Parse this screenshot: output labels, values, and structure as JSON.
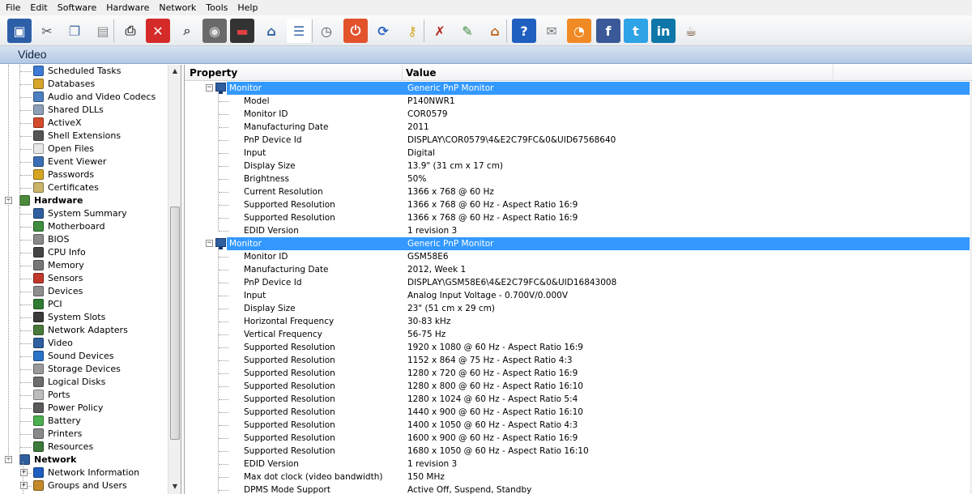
{
  "menu": [
    "File",
    "Edit",
    "Software",
    "Hardware",
    "Network",
    "Tools",
    "Help"
  ],
  "toolbar": [
    {
      "icon": "floppy-save-icon",
      "glyph": "▣",
      "bg": "#2c5fa8",
      "fg": "#ffffff"
    },
    {
      "icon": "scissors-icon",
      "glyph": "✂",
      "bg": "transparent",
      "fg": "#555555"
    },
    {
      "icon": "copy-icon",
      "glyph": "❐",
      "bg": "transparent",
      "fg": "#4a6fa5"
    },
    {
      "icon": "paste-icon",
      "glyph": "▤",
      "bg": "transparent",
      "fg": "#8a8a8a"
    },
    {
      "icon": "printer-icon",
      "glyph": "⎙",
      "bg": "transparent",
      "fg": "#444444"
    },
    {
      "icon": "stop-icon",
      "glyph": "✕",
      "bg": "#d42a2a",
      "fg": "#ffffff"
    },
    {
      "icon": "magnifier-icon",
      "glyph": "⌕",
      "bg": "transparent",
      "fg": "#555555"
    },
    {
      "icon": "compass-icon",
      "glyph": "◉",
      "bg": "#6a6a6a",
      "fg": "#e0e0e0"
    },
    {
      "icon": "monitor-graph-icon",
      "glyph": "▬",
      "bg": "#333333",
      "fg": "#e04040"
    },
    {
      "icon": "network-computer-icon",
      "glyph": "⌂",
      "bg": "transparent",
      "fg": "#2b5c9e"
    },
    {
      "icon": "list-report-icon",
      "glyph": "☰",
      "bg": "#ffffff",
      "fg": "#3a6aa8"
    },
    {
      "icon": "stopwatch-icon",
      "glyph": "◷",
      "bg": "transparent",
      "fg": "#555555"
    },
    {
      "icon": "power-icon",
      "glyph": "⏻",
      "bg": "#e2532c",
      "fg": "#ffffff"
    },
    {
      "icon": "refresh-icon",
      "glyph": "⟳",
      "bg": "transparent",
      "fg": "#2a62c0"
    },
    {
      "icon": "key-icon",
      "glyph": "⚷",
      "bg": "transparent",
      "fg": "#d6a623"
    },
    {
      "icon": "tools-icon",
      "glyph": "✗",
      "bg": "transparent",
      "fg": "#b3261e"
    },
    {
      "icon": "wizard-icon",
      "glyph": "✎",
      "bg": "transparent",
      "fg": "#3a8a3a"
    },
    {
      "icon": "home-icon",
      "glyph": "⌂",
      "bg": "transparent",
      "fg": "#c0641c"
    },
    {
      "icon": "help-icon",
      "glyph": "?",
      "bg": "#1f5fbf",
      "fg": "#ffffff"
    },
    {
      "icon": "mail-icon",
      "glyph": "✉",
      "bg": "transparent",
      "fg": "#777777"
    },
    {
      "icon": "rss-icon",
      "glyph": "◔",
      "bg": "#f08a24",
      "fg": "#ffffff"
    },
    {
      "icon": "facebook-icon",
      "glyph": "f",
      "bg": "#3b5998",
      "fg": "#ffffff"
    },
    {
      "icon": "twitter-icon",
      "glyph": "t",
      "bg": "#2ea3e6",
      "fg": "#ffffff"
    },
    {
      "icon": "linkedin-icon",
      "glyph": "in",
      "bg": "#0e76a8",
      "fg": "#ffffff"
    },
    {
      "icon": "coffee-cup-icon",
      "glyph": "☕",
      "bg": "transparent",
      "fg": "#6b3d1e"
    }
  ],
  "title": "Video",
  "tree": [
    {
      "label": "Scheduled Tasks",
      "icon": "scheduled-tasks-icon",
      "color": "#3d7bd6",
      "level": 2
    },
    {
      "label": "Databases",
      "icon": "databases-icon",
      "color": "#d7a52b",
      "level": 2
    },
    {
      "label": "Audio and Video Codecs",
      "icon": "codecs-icon",
      "color": "#4c7fbf",
      "level": 2
    },
    {
      "label": "Shared DLLs",
      "icon": "shared-dlls-icon",
      "color": "#8da0b8",
      "level": 2
    },
    {
      "label": "ActiveX",
      "icon": "activex-icon",
      "color": "#d44a2c",
      "level": 2
    },
    {
      "label": "Shell Extensions",
      "icon": "shell-extensions-icon",
      "color": "#555555",
      "level": 2
    },
    {
      "label": "Open Files",
      "icon": "open-files-icon",
      "color": "#e8e8e8",
      "level": 2
    },
    {
      "label": "Event Viewer",
      "icon": "event-viewer-icon",
      "color": "#3b6fb5",
      "level": 2
    },
    {
      "label": "Passwords",
      "icon": "key-icon",
      "color": "#d6a623",
      "level": 2
    },
    {
      "label": "Certificates",
      "icon": "certificates-icon",
      "color": "#c9b46a",
      "level": 2
    },
    {
      "label": "Hardware",
      "icon": "hardware-icon",
      "color": "#4a8a3a",
      "level": 1,
      "cat": true
    },
    {
      "label": "System Summary",
      "icon": "system-summary-icon",
      "color": "#2f5f9f",
      "level": 2
    },
    {
      "label": "Motherboard",
      "icon": "motherboard-icon",
      "color": "#3e8c3e",
      "level": 2
    },
    {
      "label": "BIOS",
      "icon": "bios-icon",
      "color": "#8a8a8a",
      "level": 2
    },
    {
      "label": "CPU Info",
      "icon": "cpu-icon",
      "color": "#444444",
      "level": 2
    },
    {
      "label": "Memory",
      "icon": "memory-icon",
      "color": "#777777",
      "level": 2
    },
    {
      "label": "Sensors",
      "icon": "sensors-icon",
      "color": "#c0392b",
      "level": 2
    },
    {
      "label": "Devices",
      "icon": "devices-icon",
      "color": "#8e8e8e",
      "level": 2
    },
    {
      "label": "PCI",
      "icon": "pci-icon",
      "color": "#2e7d32",
      "level": 2
    },
    {
      "label": "System Slots",
      "icon": "system-slots-icon",
      "color": "#3a3a3a",
      "level": 2
    },
    {
      "label": "Network Adapters",
      "icon": "network-adapters-icon",
      "color": "#4a7a3a",
      "level": 2
    },
    {
      "label": "Video",
      "icon": "video-monitor-icon",
      "color": "#2f5f9f",
      "level": 2,
      "selected": true
    },
    {
      "label": "Sound Devices",
      "icon": "sound-devices-icon",
      "color": "#2a72c8",
      "level": 2
    },
    {
      "label": "Storage Devices",
      "icon": "storage-devices-icon",
      "color": "#9a9a9a",
      "level": 2
    },
    {
      "label": "Logical Disks",
      "icon": "logical-disks-icon",
      "color": "#6d6d6d",
      "level": 2
    },
    {
      "label": "Ports",
      "icon": "ports-icon",
      "color": "#bdbdbd",
      "level": 2
    },
    {
      "label": "Power Policy",
      "icon": "power-policy-icon",
      "color": "#5a5a5a",
      "level": 2
    },
    {
      "label": "Battery",
      "icon": "battery-icon",
      "color": "#4caf50",
      "level": 2
    },
    {
      "label": "Printers",
      "icon": "printers-icon",
      "color": "#8a8a8a",
      "level": 2
    },
    {
      "label": "Resources",
      "icon": "resources-icon",
      "color": "#3b7a3b",
      "level": 2
    },
    {
      "label": "Network",
      "icon": "network-icon",
      "color": "#2f5f9f",
      "level": 1,
      "cat": true
    },
    {
      "label": "Network Information",
      "icon": "network-information-icon",
      "color": "#1f5fbf",
      "level": 2,
      "expandable": true
    },
    {
      "label": "Groups and Users",
      "icon": "groups-users-icon",
      "color": "#c48a2a",
      "level": 2,
      "expandable": true
    }
  ],
  "columns": {
    "property": "Property",
    "value": "Value"
  },
  "rows": [
    {
      "group": true,
      "name": "Monitor",
      "value": "Generic PnP Monitor"
    },
    {
      "name": "Model",
      "value": "P140NWR1"
    },
    {
      "name": "Monitor ID",
      "value": "COR0579"
    },
    {
      "name": "Manufacturing Date",
      "value": "2011"
    },
    {
      "name": "PnP Device Id",
      "value": "DISPLAY\\COR0579\\4&E2C79FC&0&UID67568640"
    },
    {
      "name": "Input",
      "value": "Digital"
    },
    {
      "name": "Display Size",
      "value": "13.9\" (31 cm x 17 cm)"
    },
    {
      "name": "Brightness",
      "value": "50%"
    },
    {
      "name": "Current Resolution",
      "value": "1366 x 768 @ 60 Hz"
    },
    {
      "name": "Supported Resolution",
      "value": "1366 x 768 @ 60 Hz - Aspect Ratio 16:9"
    },
    {
      "name": "Supported Resolution",
      "value": "1366 x 768 @ 60 Hz - Aspect Ratio 16:9"
    },
    {
      "name": "EDID Version",
      "value": "1 revision 3"
    },
    {
      "group": true,
      "name": "Monitor",
      "value": "Generic PnP Monitor"
    },
    {
      "name": "Monitor ID",
      "value": "GSM58E6"
    },
    {
      "name": "Manufacturing Date",
      "value": "2012, Week 1"
    },
    {
      "name": "PnP Device Id",
      "value": "DISPLAY\\GSM58E6\\4&E2C79FC&0&UID16843008"
    },
    {
      "name": "Input",
      "value": "Analog Input Voltage - 0.700V/0.000V"
    },
    {
      "name": "Display Size",
      "value": "23\" (51 cm x 29 cm)"
    },
    {
      "name": "Horizontal Frequency",
      "value": "30-83 kHz"
    },
    {
      "name": "Vertical Frequency",
      "value": "56-75 Hz"
    },
    {
      "name": "Supported Resolution",
      "value": "1920 x 1080 @ 60 Hz - Aspect Ratio 16:9"
    },
    {
      "name": "Supported Resolution",
      "value": "1152 x 864 @ 75 Hz - Aspect Ratio 4:3"
    },
    {
      "name": "Supported Resolution",
      "value": "1280 x 720 @ 60 Hz - Aspect Ratio 16:9"
    },
    {
      "name": "Supported Resolution",
      "value": "1280 x 800 @ 60 Hz - Aspect Ratio 16:10"
    },
    {
      "name": "Supported Resolution",
      "value": "1280 x 1024 @ 60 Hz - Aspect Ratio 5:4"
    },
    {
      "name": "Supported Resolution",
      "value": "1440 x 900 @ 60 Hz - Aspect Ratio 16:10"
    },
    {
      "name": "Supported Resolution",
      "value": "1400 x 1050 @ 60 Hz - Aspect Ratio 4:3"
    },
    {
      "name": "Supported Resolution",
      "value": "1600 x 900 @ 60 Hz - Aspect Ratio 16:9"
    },
    {
      "name": "Supported Resolution",
      "value": "1680 x 1050 @ 60 Hz - Aspect Ratio 16:10"
    },
    {
      "name": "EDID Version",
      "value": "1 revision 3"
    },
    {
      "name": "Max dot clock (video bandwidth)",
      "value": "150 MHz"
    },
    {
      "name": "DPMS Mode Support",
      "value": "Active Off, Suspend, Standby"
    }
  ]
}
